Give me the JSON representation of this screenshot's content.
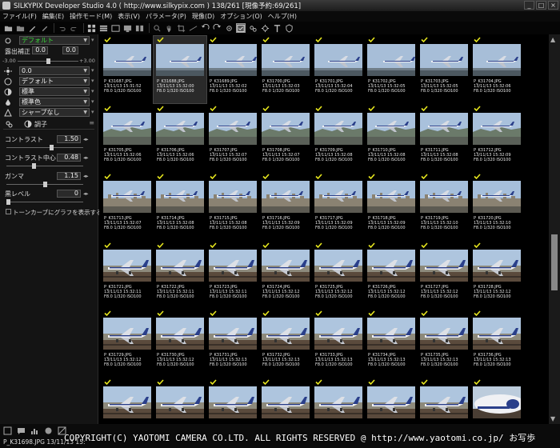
{
  "window": {
    "title": "SILKYPIX Developer Studio 4.0 ( http://www.silkypix.com )  138/261 [現像予約:69/261]"
  },
  "menu": [
    "ファイル(F)",
    "編集(E)",
    "操作モード(M)",
    "表示(V)",
    "パラメータ(P)",
    "現像(D)",
    "オプション(O)",
    "ヘルプ(H)"
  ],
  "left_panel": {
    "color_mode": "デフォルト",
    "exposure_label": "露出補正",
    "exposure_value": "0.0",
    "exposure_range_min": "-3.00",
    "exposure_range_max": "+3.00",
    "exposure_fine_value": "0.0",
    "wb_value": "0.0",
    "color_dropdown": "デフォルト",
    "tone_dropdown": "標準",
    "color_style_dropdown": "標準色",
    "sharpness_dropdown": "シャープなし",
    "tone_section": "調子",
    "contrast_label": "コントラスト",
    "contrast_value": "1.50",
    "contrast_center_label": "コントラスト中心",
    "contrast_center_value": "0.48",
    "gamma_label": "ガンマ",
    "gamma_value": "1.15",
    "black_level_label": "黒レベル",
    "black_level_value": "0",
    "tone_curve_checkbox": "トーンカーブにグラフを表示する"
  },
  "thumbnails": [
    {
      "file": "P_K31687.JPG",
      "date": "13/11/13 15:31:52",
      "info": "F8.0 1/320 ISO100",
      "checked": true,
      "scene": "sky"
    },
    {
      "file": "P_K31688.JPG",
      "date": "13/11/13 15:32:00",
      "info": "F8.0 1/320 ISO100",
      "checked": true,
      "scene": "sky",
      "selected": true
    },
    {
      "file": "P_K31689.JPG",
      "date": "13/11/13 15:32:02",
      "info": "F8.0 1/320 ISO100",
      "checked": true,
      "scene": "sky"
    },
    {
      "file": "P_K31700.JPG",
      "date": "13/11/13 15:32:03",
      "info": "F8.0 1/320 ISO100",
      "checked": true,
      "scene": "sky"
    },
    {
      "file": "P_K31701.JPG",
      "date": "13/11/13 15:32:04",
      "info": "F8.0 1/320 ISO100",
      "checked": true,
      "scene": "sky"
    },
    {
      "file": "P_K31702.JPG",
      "date": "13/11/13 15:32:05",
      "info": "F8.0 1/320 ISO100",
      "checked": true,
      "scene": "sky"
    },
    {
      "file": "P_K31703.JPG",
      "date": "13/11/13 15:32:05",
      "info": "F8.0 1/320 ISO100",
      "checked": true,
      "scene": "sky"
    },
    {
      "file": "P_K31704.JPG",
      "date": "13/11/13 15:32:06",
      "info": "F8.0 1/320 ISO100",
      "checked": true,
      "scene": "sky"
    },
    {
      "file": "P_K31705.JPG",
      "date": "13/11/13 15:32:06",
      "info": "F8.0 1/320 ISO100",
      "checked": true,
      "scene": "hills"
    },
    {
      "file": "P_K31706.JPG",
      "date": "13/11/13 15:32:06",
      "info": "F8.0 1/320 ISO100",
      "checked": true,
      "scene": "hills"
    },
    {
      "file": "P_K31707.JPG",
      "date": "13/11/13 15:32:07",
      "info": "F8.0 1/320 ISO100",
      "checked": true,
      "scene": "hills"
    },
    {
      "file": "P_K31708.JPG",
      "date": "13/11/13 15:32:07",
      "info": "F8.0 1/320 ISO100",
      "checked": true,
      "scene": "hills"
    },
    {
      "file": "P_K31709.JPG",
      "date": "13/11/13 15:32:08",
      "info": "F8.0 1/320 ISO100",
      "checked": true,
      "scene": "hills"
    },
    {
      "file": "P_K31710.JPG",
      "date": "13/11/13 15:32:08",
      "info": "F8.0 1/320 ISO100",
      "checked": true,
      "scene": "hills"
    },
    {
      "file": "P_K31711.JPG",
      "date": "13/11/13 15:32:08",
      "info": "F8.0 1/320 ISO100",
      "checked": true,
      "scene": "hills"
    },
    {
      "file": "P_K31712.JPG",
      "date": "13/11/13 15:32:09",
      "info": "F8.0 1/320 ISO100",
      "checked": true,
      "scene": "hills"
    },
    {
      "file": "P_K31713.JPG",
      "date": "13/11/13 15:32:07",
      "info": "F8.0 1/320 ISO100",
      "checked": true,
      "scene": "city"
    },
    {
      "file": "P_K31714.JPG",
      "date": "13/11/13 15:32:08",
      "info": "F8.0 1/320 ISO100",
      "checked": true,
      "scene": "city"
    },
    {
      "file": "P_K31715.JPG",
      "date": "13/11/13 15:32:08",
      "info": "F8.0 1/320 ISO100",
      "checked": true,
      "scene": "city"
    },
    {
      "file": "P_K31716.JPG",
      "date": "13/11/13 15:32:09",
      "info": "F8.0 1/320 ISO100",
      "checked": true,
      "scene": "city"
    },
    {
      "file": "P_K31717.JPG",
      "date": "13/11/13 15:32:09",
      "info": "F8.0 1/320 ISO100",
      "checked": true,
      "scene": "city"
    },
    {
      "file": "P_K31718.JPG",
      "date": "13/11/13 15:32:09",
      "info": "F8.0 1/320 ISO100",
      "checked": true,
      "scene": "city"
    },
    {
      "file": "P_K31719.JPG",
      "date": "13/11/13 15:32:10",
      "info": "F8.0 1/320 ISO100",
      "checked": true,
      "scene": "city"
    },
    {
      "file": "P_K31720.JPG",
      "date": "13/11/13 15:32:10",
      "info": "F8.0 1/320 ISO100",
      "checked": true,
      "scene": "city"
    },
    {
      "file": "P_K31721.JPG",
      "date": "13/11/13 15:32:11",
      "info": "F8.0 1/320 ISO100",
      "checked": true,
      "scene": "runway"
    },
    {
      "file": "P_K31722.JPG",
      "date": "13/11/13 15:32:11",
      "info": "F8.0 1/320 ISO100",
      "checked": true,
      "scene": "runway"
    },
    {
      "file": "P_K31723.JPG",
      "date": "13/11/13 15:32:11",
      "info": "F8.0 1/320 ISO100",
      "checked": true,
      "scene": "runway"
    },
    {
      "file": "P_K31724.JPG",
      "date": "13/11/13 15:32:12",
      "info": "F8.0 1/320 ISO100",
      "checked": true,
      "scene": "runway"
    },
    {
      "file": "P_K31725.JPG",
      "date": "13/11/13 15:32:12",
      "info": "F8.0 1/320 ISO100",
      "checked": true,
      "scene": "runway"
    },
    {
      "file": "P_K31726.JPG",
      "date": "13/11/13 15:32:12",
      "info": "F8.0 1/320 ISO100",
      "checked": true,
      "scene": "runway"
    },
    {
      "file": "P_K31727.JPG",
      "date": "13/11/13 15:32:12",
      "info": "F8.0 1/320 ISO100",
      "checked": true,
      "scene": "runway"
    },
    {
      "file": "P_K31728.JPG",
      "date": "13/11/13 15:32:12",
      "info": "F8.0 1/320 ISO100",
      "checked": true,
      "scene": "runway"
    },
    {
      "file": "P_K31729.JPG",
      "date": "13/11/13 15:32:12",
      "info": "F8.0 1/320 ISO100",
      "checked": true,
      "scene": "runway"
    },
    {
      "file": "P_K31730.JPG",
      "date": "13/11/13 15:32:12",
      "info": "F8.0 1/320 ISO100",
      "checked": true,
      "scene": "runway"
    },
    {
      "file": "P_K31731.JPG",
      "date": "13/11/13 15:32:13",
      "info": "F8.0 1/320 ISO100",
      "checked": true,
      "scene": "runway"
    },
    {
      "file": "P_K31732.JPG",
      "date": "13/11/13 15:32:13",
      "info": "F8.0 1/320 ISO100",
      "checked": true,
      "scene": "runway"
    },
    {
      "file": "P_K31733.JPG",
      "date": "13/11/13 15:32:13",
      "info": "F8.0 1/320 ISO100",
      "checked": true,
      "scene": "runway"
    },
    {
      "file": "P_K31734.JPG",
      "date": "13/11/13 15:32:13",
      "info": "F8.0 1/320 ISO100",
      "checked": true,
      "scene": "runway"
    },
    {
      "file": "P_K31735.JPG",
      "date": "13/11/13 15:32:13",
      "info": "F8.0 1/320 ISO100",
      "checked": true,
      "scene": "runway"
    },
    {
      "file": "P_K31736.JPG",
      "date": "13/11/13 15:32:13",
      "info": "F8.0 1/320 ISO100",
      "checked": true,
      "scene": "runway"
    },
    {
      "file": "",
      "date": "",
      "info": "",
      "checked": true,
      "scene": "runway"
    },
    {
      "file": "",
      "date": "",
      "info": "",
      "checked": true,
      "scene": "runway"
    },
    {
      "file": "",
      "date": "",
      "info": "",
      "checked": true,
      "scene": "runway"
    },
    {
      "file": "",
      "date": "",
      "info": "",
      "checked": true,
      "scene": "runway"
    },
    {
      "file": "",
      "date": "",
      "info": "",
      "checked": true,
      "scene": "runway"
    },
    {
      "file": "",
      "date": "",
      "info": "",
      "checked": true,
      "scene": "runway"
    },
    {
      "file": "",
      "date": "",
      "info": "",
      "checked": true,
      "scene": "runway"
    },
    {
      "file": "",
      "date": "",
      "info": "",
      "checked": true,
      "scene": "closeup"
    }
  ],
  "status": {
    "text": "P_K31698.JPG 13/11/13 15:",
    "copyright": "COPYRIGHT(C) YAOTOMI CAMERA CO.LTD. ALL RIGHTS RESERVED @ http://www.yaotomi.co.jp/ お写歩"
  },
  "colors": {
    "accent_green": "#3ad83a",
    "check_yellow": "#e6e61e",
    "sky": "#a9c0da",
    "plane_blue": "#2a3f8a"
  }
}
